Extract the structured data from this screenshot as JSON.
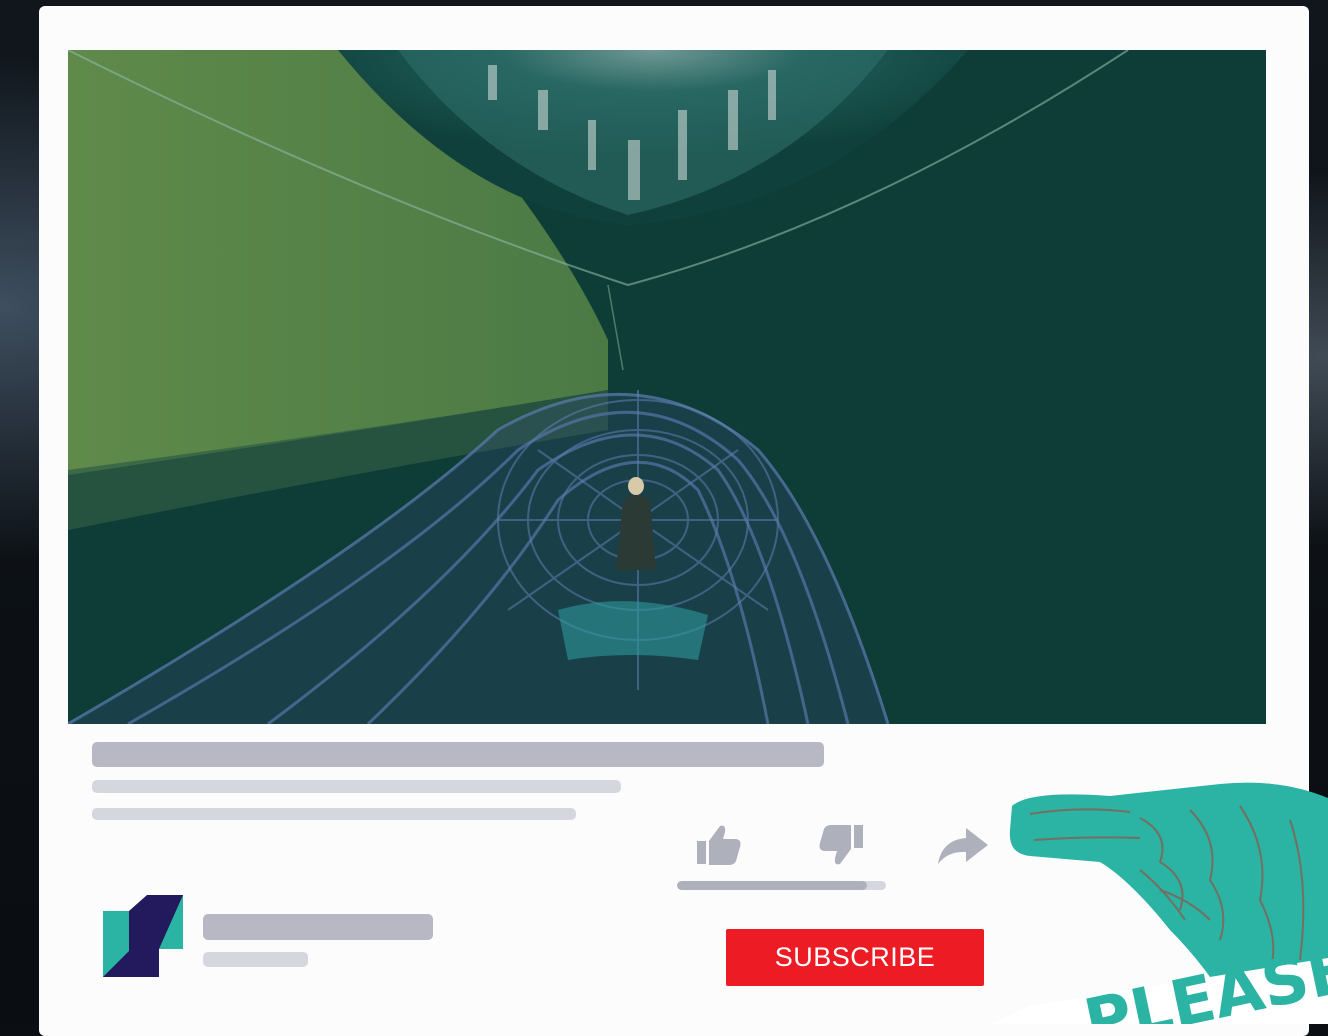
{
  "video": {
    "scene": "tunnel-roller-coaster-frame"
  },
  "actions": {
    "like_icon": "thumbs-up-icon",
    "dislike_icon": "thumbs-down-icon",
    "share_icon": "share-arrow-icon",
    "like_ratio": 0.91
  },
  "subscribe": {
    "label": "SUBSCRIBE"
  },
  "overlay": {
    "sticker_text": "PLEASE",
    "sticker_icon": "pointing-hand-icon"
  },
  "colors": {
    "subscribe_red": "#ed1c24",
    "teal_accent": "#2bb3a3",
    "logo_navy": "#231a5e",
    "skeleton_gray": "#b7b8c4"
  }
}
